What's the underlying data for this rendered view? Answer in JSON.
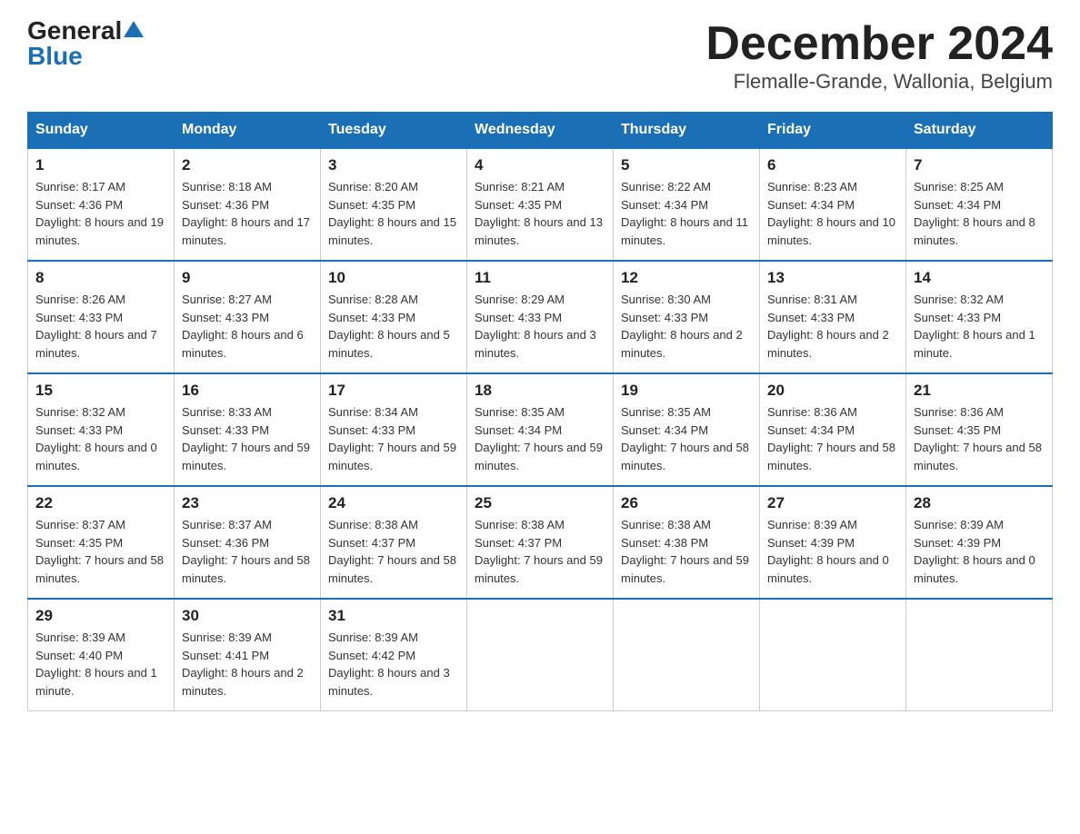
{
  "logo": {
    "general": "General",
    "blue": "Blue"
  },
  "title": "December 2024",
  "subtitle": "Flemalle-Grande, Wallonia, Belgium",
  "days_of_week": [
    "Sunday",
    "Monday",
    "Tuesday",
    "Wednesday",
    "Thursday",
    "Friday",
    "Saturday"
  ],
  "weeks": [
    [
      {
        "day": "1",
        "sunrise": "8:17 AM",
        "sunset": "4:36 PM",
        "daylight": "8 hours and 19 minutes."
      },
      {
        "day": "2",
        "sunrise": "8:18 AM",
        "sunset": "4:36 PM",
        "daylight": "8 hours and 17 minutes."
      },
      {
        "day": "3",
        "sunrise": "8:20 AM",
        "sunset": "4:35 PM",
        "daylight": "8 hours and 15 minutes."
      },
      {
        "day": "4",
        "sunrise": "8:21 AM",
        "sunset": "4:35 PM",
        "daylight": "8 hours and 13 minutes."
      },
      {
        "day": "5",
        "sunrise": "8:22 AM",
        "sunset": "4:34 PM",
        "daylight": "8 hours and 11 minutes."
      },
      {
        "day": "6",
        "sunrise": "8:23 AM",
        "sunset": "4:34 PM",
        "daylight": "8 hours and 10 minutes."
      },
      {
        "day": "7",
        "sunrise": "8:25 AM",
        "sunset": "4:34 PM",
        "daylight": "8 hours and 8 minutes."
      }
    ],
    [
      {
        "day": "8",
        "sunrise": "8:26 AM",
        "sunset": "4:33 PM",
        "daylight": "8 hours and 7 minutes."
      },
      {
        "day": "9",
        "sunrise": "8:27 AM",
        "sunset": "4:33 PM",
        "daylight": "8 hours and 6 minutes."
      },
      {
        "day": "10",
        "sunrise": "8:28 AM",
        "sunset": "4:33 PM",
        "daylight": "8 hours and 5 minutes."
      },
      {
        "day": "11",
        "sunrise": "8:29 AM",
        "sunset": "4:33 PM",
        "daylight": "8 hours and 3 minutes."
      },
      {
        "day": "12",
        "sunrise": "8:30 AM",
        "sunset": "4:33 PM",
        "daylight": "8 hours and 2 minutes."
      },
      {
        "day": "13",
        "sunrise": "8:31 AM",
        "sunset": "4:33 PM",
        "daylight": "8 hours and 2 minutes."
      },
      {
        "day": "14",
        "sunrise": "8:32 AM",
        "sunset": "4:33 PM",
        "daylight": "8 hours and 1 minute."
      }
    ],
    [
      {
        "day": "15",
        "sunrise": "8:32 AM",
        "sunset": "4:33 PM",
        "daylight": "8 hours and 0 minutes."
      },
      {
        "day": "16",
        "sunrise": "8:33 AM",
        "sunset": "4:33 PM",
        "daylight": "7 hours and 59 minutes."
      },
      {
        "day": "17",
        "sunrise": "8:34 AM",
        "sunset": "4:33 PM",
        "daylight": "7 hours and 59 minutes."
      },
      {
        "day": "18",
        "sunrise": "8:35 AM",
        "sunset": "4:34 PM",
        "daylight": "7 hours and 59 minutes."
      },
      {
        "day": "19",
        "sunrise": "8:35 AM",
        "sunset": "4:34 PM",
        "daylight": "7 hours and 58 minutes."
      },
      {
        "day": "20",
        "sunrise": "8:36 AM",
        "sunset": "4:34 PM",
        "daylight": "7 hours and 58 minutes."
      },
      {
        "day": "21",
        "sunrise": "8:36 AM",
        "sunset": "4:35 PM",
        "daylight": "7 hours and 58 minutes."
      }
    ],
    [
      {
        "day": "22",
        "sunrise": "8:37 AM",
        "sunset": "4:35 PM",
        "daylight": "7 hours and 58 minutes."
      },
      {
        "day": "23",
        "sunrise": "8:37 AM",
        "sunset": "4:36 PM",
        "daylight": "7 hours and 58 minutes."
      },
      {
        "day": "24",
        "sunrise": "8:38 AM",
        "sunset": "4:37 PM",
        "daylight": "7 hours and 58 minutes."
      },
      {
        "day": "25",
        "sunrise": "8:38 AM",
        "sunset": "4:37 PM",
        "daylight": "7 hours and 59 minutes."
      },
      {
        "day": "26",
        "sunrise": "8:38 AM",
        "sunset": "4:38 PM",
        "daylight": "7 hours and 59 minutes."
      },
      {
        "day": "27",
        "sunrise": "8:39 AM",
        "sunset": "4:39 PM",
        "daylight": "8 hours and 0 minutes."
      },
      {
        "day": "28",
        "sunrise": "8:39 AM",
        "sunset": "4:39 PM",
        "daylight": "8 hours and 0 minutes."
      }
    ],
    [
      {
        "day": "29",
        "sunrise": "8:39 AM",
        "sunset": "4:40 PM",
        "daylight": "8 hours and 1 minute."
      },
      {
        "day": "30",
        "sunrise": "8:39 AM",
        "sunset": "4:41 PM",
        "daylight": "8 hours and 2 minutes."
      },
      {
        "day": "31",
        "sunrise": "8:39 AM",
        "sunset": "4:42 PM",
        "daylight": "8 hours and 3 minutes."
      },
      null,
      null,
      null,
      null
    ]
  ]
}
